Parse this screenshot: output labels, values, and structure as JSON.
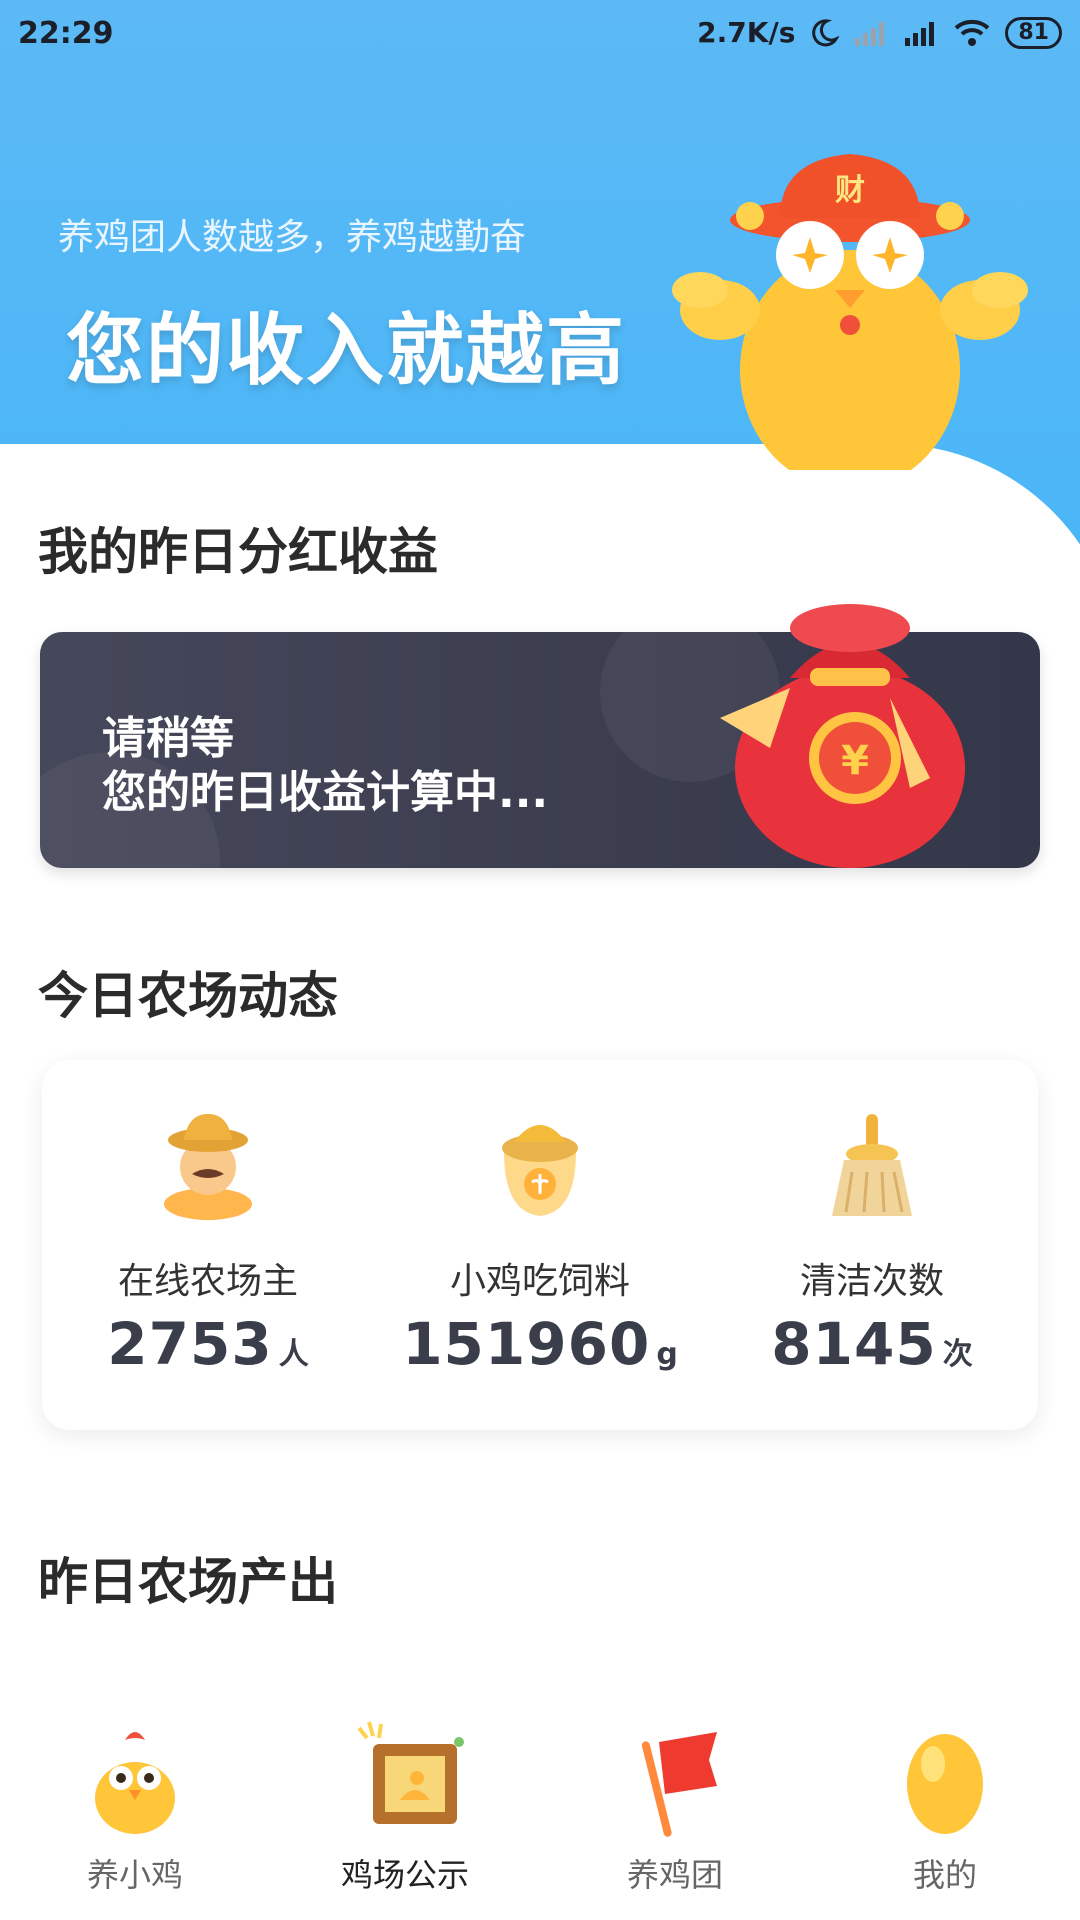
{
  "status": {
    "time": "22:29",
    "network_speed": "2.7K/s",
    "battery": "81"
  },
  "hero": {
    "subtitle": "养鸡团人数越多，养鸡越勤奋",
    "title": "您的收入就越高",
    "mascot_badge": "财"
  },
  "dividend": {
    "section_title": "我的昨日分红收益",
    "line1": "请稍等",
    "line2": "您的昨日收益计算中...",
    "bag_symbol": "¥"
  },
  "farm_today": {
    "section_title": "今日农场动态",
    "stats": [
      {
        "label": "在线农场主",
        "value": "2753",
        "unit": "人",
        "icon": "farmer-icon"
      },
      {
        "label": "小鸡吃饲料",
        "value": "151960",
        "unit": "g",
        "icon": "feed-sack-icon"
      },
      {
        "label": "清洁次数",
        "value": "8145",
        "unit": "次",
        "icon": "broom-icon"
      }
    ]
  },
  "farm_yesterday": {
    "section_title": "昨日农场产出"
  },
  "nav": {
    "items": [
      {
        "label": "养小鸡",
        "icon": "chick-icon"
      },
      {
        "label": "鸡场公示",
        "icon": "notice-board-icon"
      },
      {
        "label": "养鸡团",
        "icon": "flag-icon"
      },
      {
        "label": "我的",
        "icon": "golden-egg-icon"
      }
    ],
    "active_index": 1
  },
  "colors": {
    "hero_blue": "#4ab6f7",
    "card_dark": "#3b3d4f",
    "mascot_yellow": "#ffc63a",
    "bag_red": "#e8333c"
  }
}
